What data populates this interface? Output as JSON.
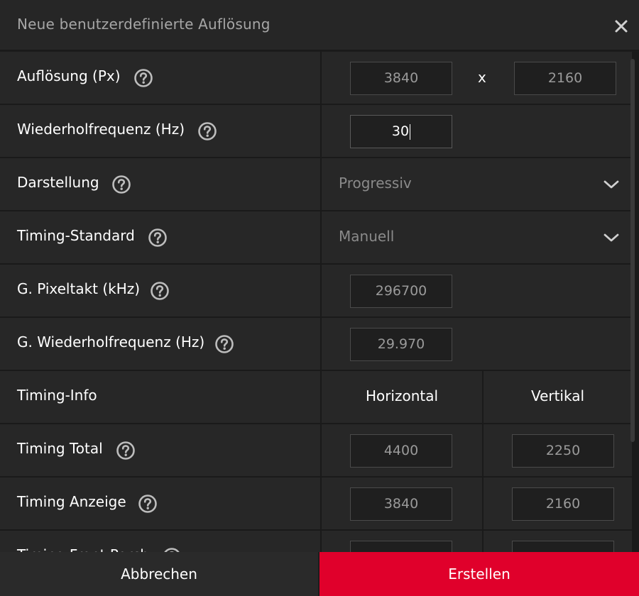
{
  "dialog": {
    "title": "Neue benutzerdefinierte Auflösung"
  },
  "rows": {
    "resolution": {
      "label": "Auflösung (Px)",
      "width": "3840",
      "separator": "x",
      "height": "2160"
    },
    "refresh": {
      "label": "Wiederholfrequenz (Hz)",
      "value": "30"
    },
    "scan": {
      "label": "Darstellung",
      "selected": "Progressiv"
    },
    "timing_standard": {
      "label": "Timing-Standard",
      "selected": "Manuell"
    },
    "pixel_clock": {
      "label": "G. Pixeltakt (kHz)",
      "value": "296700"
    },
    "g_refresh": {
      "label": "G. Wiederholfrequenz (Hz)",
      "value": "29.970"
    },
    "timing_info": {
      "label": "Timing-Info",
      "col_h": "Horizontal",
      "col_v": "Vertikal"
    },
    "timing_total": {
      "label": "Timing Total",
      "h": "4400",
      "v": "2250"
    },
    "timing_display": {
      "label": "Timing Anzeige",
      "h": "3840",
      "v": "2160"
    },
    "timing_front_porch": {
      "label": "Timing Front Porch",
      "h": "",
      "v": ""
    }
  },
  "footer": {
    "cancel_label": "Abbrechen",
    "create_label": "Erstellen"
  },
  "colors": {
    "accent": "#e0002b",
    "background": "#272727"
  },
  "icons": {
    "close": "close-icon",
    "help": "help-icon",
    "dropdown": "chevron-down-icon"
  }
}
